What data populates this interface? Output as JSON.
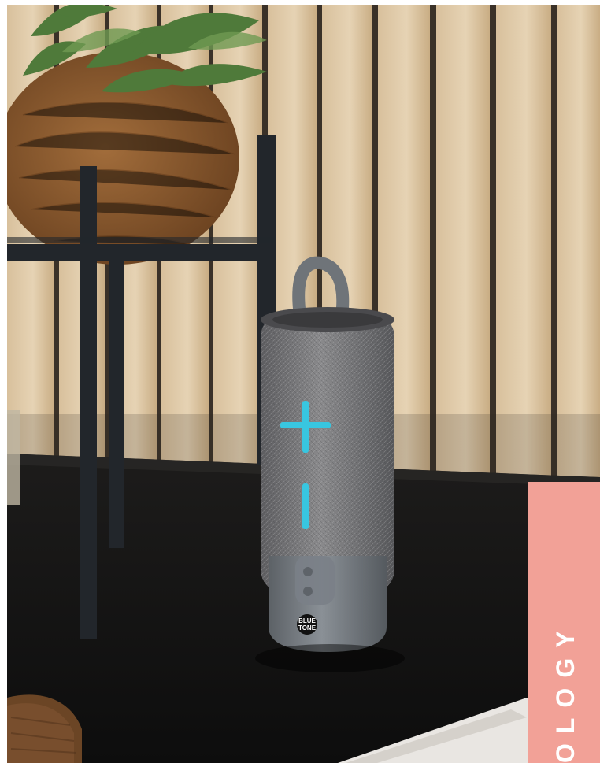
{
  "scene": {
    "description_words": "product-photo",
    "palette": {
      "wood_light": "#dcc7a6",
      "wood_dark": "#b89a72",
      "slat_gap": "#3a3128",
      "shelf": "#141414",
      "speaker_fabric": "#6e6e70",
      "speaker_base": "#6f7479",
      "button_glow": "#38c6e0",
      "plant_green": "#4f7a3a",
      "coir": "#8a5a2e",
      "stand_metal": "#22262b"
    }
  },
  "speaker": {
    "logo_text": "BLUE\nTONE",
    "plus_icon": "plus-icon",
    "minus_icon": "minus-icon"
  },
  "side_tab": {
    "text": "OLOGY",
    "color": "#f2a197"
  }
}
